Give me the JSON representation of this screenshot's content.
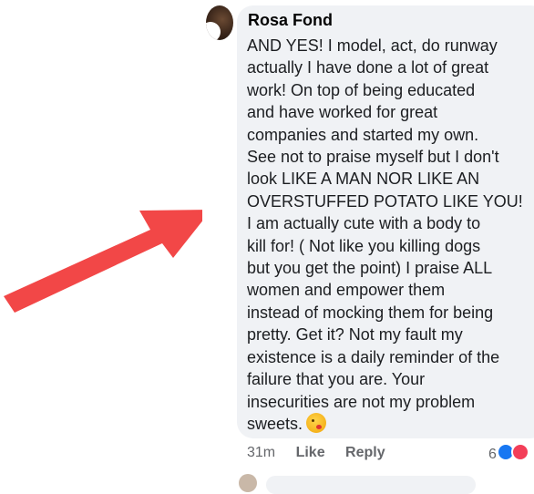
{
  "comment": {
    "author": "Rosa Fond",
    "text": "AND YES! I model, act, do runway\nactually I have done a lot of great\nwork! On top of being educated\nand have worked for great\ncompanies and started my own.\nSee not to praise myself but I don't\nlook LIKE A MAN NOR LIKE AN\nOVERSTUFFED POTATO LIKE YOU!\nI am actually cute with a body to\nkill for! ( Not like you killing dogs\nbut you get the point) I praise ALL\nwomen and empower them\ninstead of mocking them for being\npretty. Get it? Not my fault my\nexistence is a daily reminder of the\nfailure that you are. Your\ninsecurities are not my problem\nsweets.",
    "emoji": "kissing-face-emoji",
    "timestamp": "31m",
    "like_label": "Like",
    "reply_label": "Reply",
    "reaction_count": "6",
    "reaction_icons": [
      "like-icon",
      "love-icon"
    ]
  },
  "colors": {
    "arrow": "#f24747",
    "bubble": "#f0f2f5",
    "meta": "#65676b"
  }
}
